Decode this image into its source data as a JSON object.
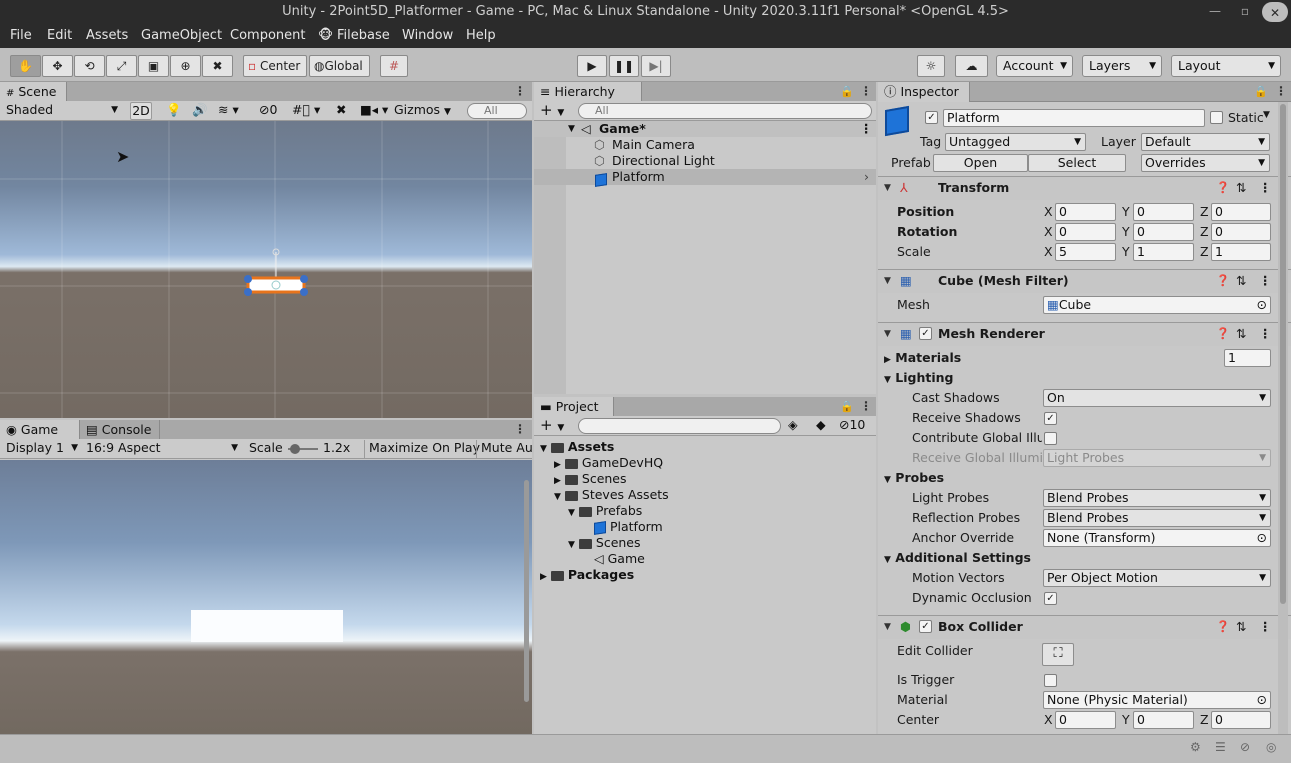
{
  "window": {
    "title": "Unity - 2Point5D_Platformer - Game - PC, Mac & Linux Standalone - Unity 2020.3.11f1 Personal* <OpenGL 4.5>"
  },
  "menu": [
    "File",
    "Edit",
    "Assets",
    "GameObject",
    "Component",
    "Filebase",
    "Window",
    "Help"
  ],
  "toolbar": {
    "pivot": "Center",
    "space": "Global",
    "account": "Account",
    "layers": "Layers",
    "layout": "Layout"
  },
  "scene": {
    "tab": "Scene",
    "shading": "Shaded",
    "mode2d": "2D",
    "hidden_count": "0",
    "gizmos": "Gizmos",
    "search_placeholder": "All"
  },
  "game": {
    "tab": "Game",
    "console_tab": "Console",
    "display": "Display 1",
    "aspect": "16:9 Aspect",
    "scale_label": "Scale",
    "scale_value": "1.2x",
    "maximize": "Maximize On Play",
    "mute": "Mute Audio"
  },
  "hierarchy": {
    "tab": "Hierarchy",
    "search_placeholder": "All",
    "scene": "Game*",
    "items": [
      "Main Camera",
      "Directional Light",
      "Platform"
    ]
  },
  "project": {
    "tab": "Project",
    "hidden_count": "10",
    "assets": "Assets",
    "folders": [
      "GameDevHQ",
      "Scenes",
      "Steves Assets"
    ],
    "prefabs": "Prefabs",
    "prefab_item": "Platform",
    "scenes_sub": "Scenes",
    "scene_item": "Game",
    "packages": "Packages"
  },
  "inspector": {
    "tab": "Inspector",
    "object_name": "Platform",
    "static_label": "Static",
    "tag_label": "Tag",
    "tag_value": "Untagged",
    "layer_label": "Layer",
    "layer_value": "Default",
    "prefab_label": "Prefab",
    "prefab_open": "Open",
    "prefab_select": "Select",
    "prefab_overrides": "Overrides",
    "transform": {
      "title": "Transform",
      "position_label": "Position",
      "rotation_label": "Rotation",
      "scale_label": "Scale",
      "position": [
        "0",
        "0",
        "0"
      ],
      "rotation": [
        "0",
        "0",
        "0"
      ],
      "scale": [
        "5",
        "1",
        "1"
      ]
    },
    "mesh_filter": {
      "title": "Cube (Mesh Filter)",
      "mesh_label": "Mesh",
      "mesh_value": "Cube"
    },
    "mesh_renderer": {
      "title": "Mesh Renderer",
      "materials_label": "Materials",
      "materials_count": "1",
      "lighting_label": "Lighting",
      "cast_shadows_label": "Cast Shadows",
      "cast_shadows_value": "On",
      "receive_shadows_label": "Receive Shadows",
      "contribute_gi_label": "Contribute Global Illumi",
      "receive_gi_label": "Receive Global Illumina",
      "receive_gi_value": "Light Probes",
      "probes_label": "Probes",
      "light_probes_label": "Light Probes",
      "light_probes_value": "Blend Probes",
      "reflection_probes_label": "Reflection Probes",
      "reflection_probes_value": "Blend Probes",
      "anchor_override_label": "Anchor Override",
      "anchor_override_value": "None (Transform)",
      "additional_label": "Additional Settings",
      "motion_vectors_label": "Motion Vectors",
      "motion_vectors_value": "Per Object Motion",
      "dynamic_occlusion_label": "Dynamic Occlusion"
    },
    "box_collider": {
      "title": "Box Collider",
      "edit_collider_label": "Edit Collider",
      "is_trigger_label": "Is Trigger",
      "material_label": "Material",
      "material_value": "None (Physic Material)",
      "center_label": "Center",
      "center": [
        "0",
        "0",
        "0"
      ]
    }
  },
  "colors": {
    "accent_blue": "#1e73d8",
    "selection": "#bcbcbc",
    "panel_bg": "#c8c8c8",
    "title_bg": "#2b2b2b"
  }
}
